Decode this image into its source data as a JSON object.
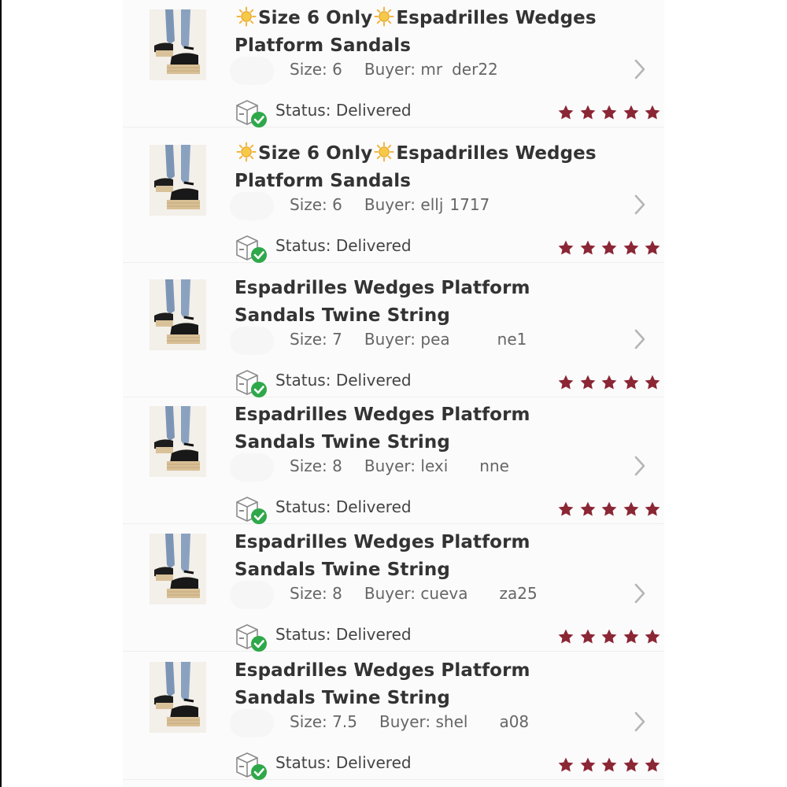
{
  "colors": {
    "star": "#8b2635",
    "check": "#2ea84a",
    "title": "#333333",
    "meta": "#666666"
  },
  "labels": {
    "size_prefix": "Size:",
    "buyer_prefix": "Buyer:",
    "status_prefix": "Status:"
  },
  "orders": [
    {
      "title_parts": [
        "sun-icon",
        "Size 6 Only",
        "sun-icon",
        "Espadrilles Wedges Platform Sandals"
      ],
      "size": "6",
      "buyer": "mr   der22",
      "status": "Delivered",
      "rating": 5
    },
    {
      "title_parts": [
        "sun-icon",
        "Size 6 Only",
        "sun-icon",
        "Espadrilles Wedges Platform Sandals"
      ],
      "size": "6",
      "buyer": "ellj  1717",
      "status": "Delivered",
      "rating": 5
    },
    {
      "title_parts": [
        "Espadrilles Wedges Platform Sandals Twine String"
      ],
      "size": "7",
      "buyer": "pea   ne1",
      "status": "Delivered",
      "rating": 5
    },
    {
      "title_parts": [
        "Espadrilles Wedges Platform Sandals Twine String"
      ],
      "size": "8",
      "buyer": "lexi  nne",
      "status": "Delivered",
      "rating": 5
    },
    {
      "title_parts": [
        "Espadrilles Wedges Platform Sandals Twine String"
      ],
      "size": "8",
      "buyer": "cueva  za25",
      "status": "Delivered",
      "rating": 5
    },
    {
      "title_parts": [
        "Espadrilles Wedges Platform Sandals Twine String"
      ],
      "size": "7.5",
      "buyer": "shel  a08",
      "status": "Delivered",
      "rating": 5
    }
  ]
}
